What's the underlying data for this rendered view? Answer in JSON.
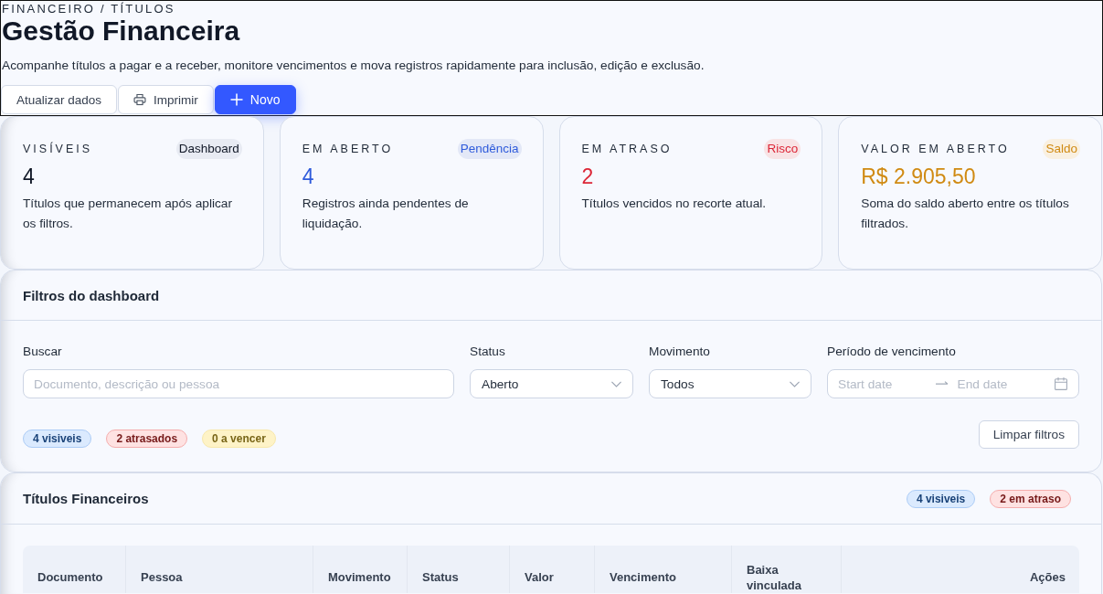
{
  "header": {
    "breadcrumb": "FINANCEIRO / TÍTULOS",
    "title": "Gestão Financeira",
    "description": "Acompanhe títulos a pagar e a receber, monitore vencimentos e mova registros rapidamente para inclusão, edição e exclusão.",
    "actions": [
      {
        "label": "Atualizar dados",
        "kind": "plain"
      },
      {
        "label": "Imprimir",
        "kind": "print"
      },
      {
        "label": "Novo",
        "kind": "new"
      }
    ]
  },
  "kpi_cards": [
    {
      "label": "VISÍVEIS",
      "tag": "Dashboard",
      "value": "4",
      "description": "Títulos que permanecem após aplicar os filtros.",
      "color": "#111827"
    },
    {
      "label": "EM ABERTO",
      "tag": "Pendência",
      "value": "4",
      "description": "Registros ainda pendentes de liquidação.",
      "color": "#2f5bdb"
    },
    {
      "label": "EM ATRASO",
      "tag": "Risco",
      "value": "2",
      "description": "Títulos vencidos no recorte atual.",
      "color": "#dc2637"
    },
    {
      "label": "VALOR EM ABERTO",
      "tag": "Saldo",
      "value": "R$ 2.905,50",
      "description": "Soma do saldo aberto entre os títulos filtrados.",
      "color": "#d08a12"
    }
  ],
  "filters": {
    "title": "Filtros do dashboard",
    "search": {
      "label": "Buscar",
      "placeholder": "Documento, descrição ou pessoa"
    },
    "status": {
      "label": "Status",
      "value": "Aberto"
    },
    "movement": {
      "label": "Movimento",
      "value": "Todos"
    },
    "due_period": {
      "label": "Período de vencimento",
      "start_placeholder": "Start date",
      "end_placeholder": "End date"
    },
    "counters": [
      {
        "text": "4 visiveis",
        "color": "#dbeafe"
      },
      {
        "text": "2 atrasados",
        "color": "#fee2e2"
      },
      {
        "text": "0 a vencer",
        "color": "#fef3c7"
      }
    ],
    "clear_button": "Limpar filtros"
  },
  "table": {
    "title": "Títulos Financeiros",
    "counters": [
      {
        "text": "4 visiveis",
        "color": "#dbeafe"
      },
      {
        "text": "2 em atraso",
        "color": "#fee2e2"
      }
    ],
    "columns": [
      "Documento",
      "Pessoa",
      "Movimento",
      "Status",
      "Valor",
      "Vencimento",
      "Baixa vinculada",
      "Ações"
    ]
  }
}
